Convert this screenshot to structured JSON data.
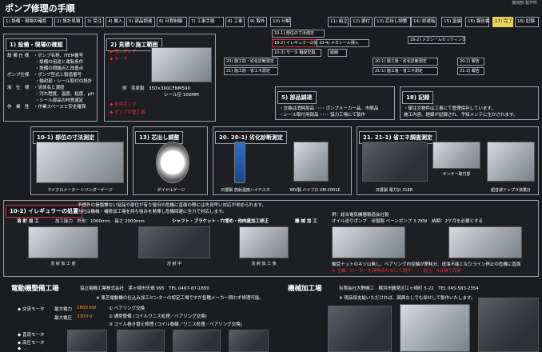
{
  "page": {
    "title": "ポンプ修理の手順",
    "header_note": "機械部 製作所"
  },
  "flow": {
    "steps": [
      "1) 設備・現場の確認",
      "2) 設計見積",
      "3) 受注",
      "4) 搬入",
      "5) 部品調達",
      "6) 日程制御",
      "7) 工事手順",
      "8) 工事",
      "9) 取外",
      "10) 分解",
      "11) 組立",
      "12) 据付",
      "13) 芯出し調整",
      "14) 試運転",
      "15) 塗装",
      "16) 報告書",
      "17) 完了",
      "18) 記録"
    ],
    "subs": [
      "10-1) 部位の寸法測定",
      "10-2) イレギュラーの処置",
      "10-3) モータ 軸受交換",
      "10-4) メカシール挿入",
      "結線",
      "18-2) メカシールセッティング",
      "20) 施工前・劣化診断測定",
      "21) 施工前・省エネ測定",
      "20-1) 施工後・劣化診断測定",
      "21-1) 施工後・省エネ測定",
      "20-2) 報告",
      "21-2) 報告"
    ]
  },
  "p1": {
    "title": "1) 設備・現場の確認",
    "rows": [
      "設 備 仕 様　・ポンプ名称、ITEM番号",
      "　　　　　　 ・設備の用途と運転条件",
      "　　　　　　 ・設備の問題点と改善点",
      "ポンプ仕様　・ポンプ型式と製造番号",
      "　　　　　　 ・軸封部・シール取付の設計",
      "液　仕　様　・流体名と濃度",
      "　　　　　　 ・汚れ程度、温度、粘度、pH",
      "　　　　　　 ・シール部品の材質選定",
      "作　業　性　・作業スペースと安全確保"
    ]
  },
  "p2": {
    "title": "2) 見積り施工範囲",
    "items": [
      "◆ 陸上ポンプ",
      "◆ モータ",
      "◆ 水中ポンプ",
      "◆ ポンプの管工事"
    ],
    "example": "例　荏原製　350×300CFNM590",
    "example2": "シール径 100MM"
  },
  "p5": {
    "title": "5) 部品調達",
    "rows": [
      "・交換は消耗部品 ････ ポンプメーカー品、市販品",
      "・シール取付用部品 ････ 協力工場にて製作"
    ]
  },
  "p18": {
    "title": "18) 記録",
    "rows": [
      "・御注文物件は工事にて管理保存しています。",
      "施工内容、経緯が記録され、予知メンテに生かされます。"
    ]
  },
  "m1": {
    "title": "10-1) 部位の寸法測定",
    "cap": "マイクロメーター シリンダーゲージ"
  },
  "m13": {
    "title": "13) 芯出し調整",
    "cap": "ダイヤルゲージ"
  },
  "m20": {
    "title": "20. 20-1) 劣化診断測定",
    "cap1": "日置製 放射温度ハイテスタ",
    "cap2": "IMV製 バイブロ VM-2001Σ"
  },
  "m21": {
    "title": "21. 21-1) 省エネ調査測定",
    "cap1": "日置製 電力計 3168",
    "cap2": "センサー取付部",
    "cap3": "超音波ドップラ流量計"
  },
  "irreg": {
    "title": "10-2) イレギュラーの処置",
    "line1": "予想外の損傷兼ない部品や部位が有り復旧の危機に直面の際には先見早い対応が求められます。",
    "line2": "当社は機械・補修加工場を持ち強みを発揮し危機回避に全力で対応します。",
    "weld_label": "溶 射 加 工",
    "weld_desc": "加工能力　外形：1000mm　長さ 2000mm",
    "weld_parts": "シャフト・ブラケット・穴埋め・他肉盛加工修正",
    "machine_label": "機 械 加 工",
    "example": "例：総合電気機器製造会社製",
    "example2": "オイル送りポンプ　米国製 ベーンポンプ 3.7KW　納期：2ケ月を必要とする",
    "caps": [
      "溶 射 加 工 前",
      "溶 射 中",
      "溶 射 加 工 後"
    ],
    "note1": "軸受ナットのネジ山無し、ベアリング内径軸が摩耗分、送油不能となりライン停止の危機に直面",
    "note2": "※ 主軸、ローターを現物合わせにて製作 ････ 組立、4日間で完納"
  },
  "elec": {
    "title": "電動機整備工場",
    "company": "協立電機工業株式会社　茅ヶ崎市矢畑 995　TEL 0467-87-1850",
    "note": "※ 東芝電動機の仕込み加工センターの認定工場ですが各種メーカー問わず修理可能。",
    "ac_label": "◆ 交流モータ",
    "ac_maxout_label": "最大電力",
    "ac_maxout": "1600 kW",
    "ac_maxv_label": "最大電圧",
    "ac_maxv": "3300 V",
    "rows": [
      "① ベアリング交換",
      "② 通常整備 (コイルワニス処理／ベアリング交換)",
      "③ コイル巻き替え修理 (コイル巻線／ワニス処理／ベアリング交換)"
    ],
    "dc": "◆ 直流モータ",
    "hv": "◆ 高圧モータ",
    "more": "◆ ..."
  },
  "mach": {
    "title": "機械加工場",
    "company": "有限会社大野機工　横浜市鶴見区江ヶ崎町 5-22　TEL 045-583-2354",
    "note": "※ 現品保支給いただければ、図面なしでも探せして製作いたします。"
  },
  "colors": {
    "bg": "#1a1c20",
    "accent_red": "#e0303a",
    "accent_orange": "#ff9c2a",
    "highlight": "#e8d25a"
  }
}
